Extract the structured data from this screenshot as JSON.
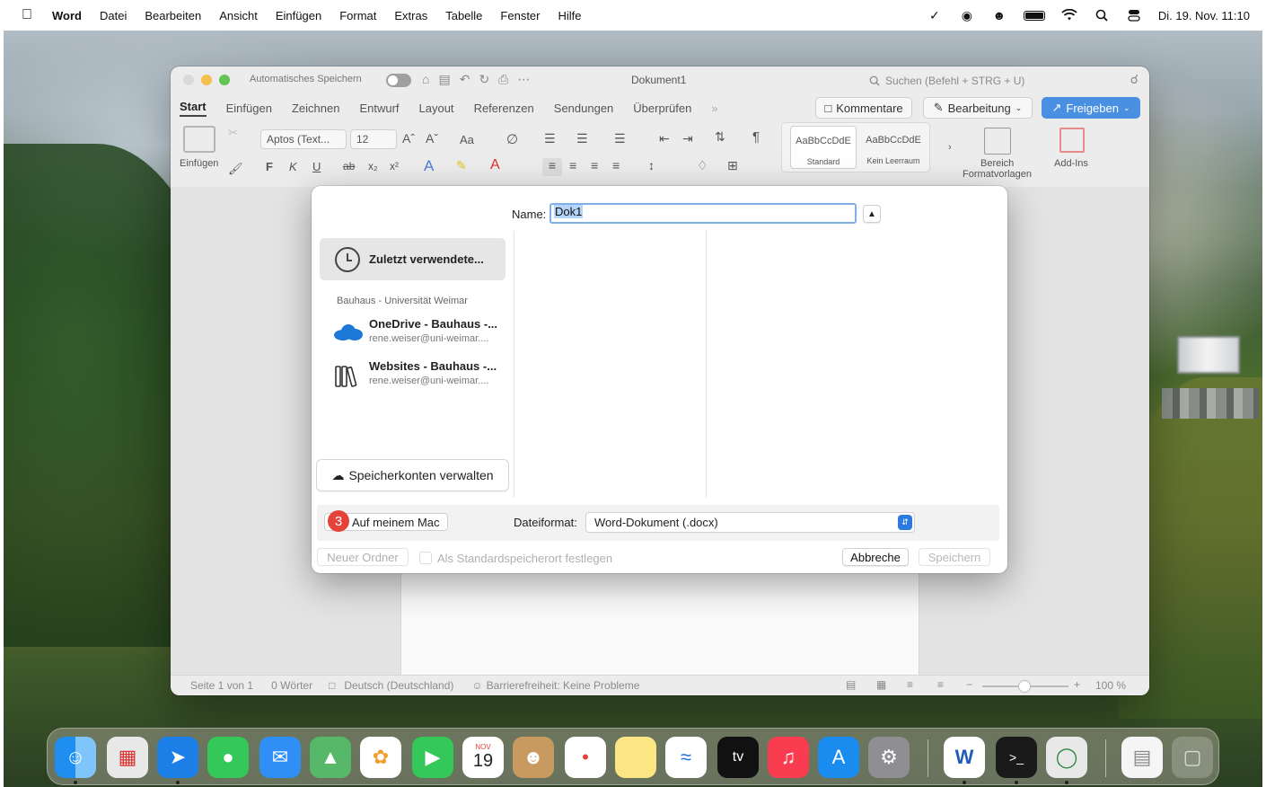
{
  "menubar": {
    "app_name": "Word",
    "items": [
      "Datei",
      "Bearbeiten",
      "Ansicht",
      "Einfügen",
      "Format",
      "Extras",
      "Tabelle",
      "Fenster",
      "Hilfe"
    ],
    "datetime": "Di. 19. Nov. 11:10"
  },
  "window": {
    "autosave_label": "Automatisches Speichern",
    "doc_title": "Dokument1",
    "search_placeholder": "Suchen (Befehl + STRG + U)",
    "tabs": [
      "Start",
      "Einfügen",
      "Zeichnen",
      "Entwurf",
      "Layout",
      "Referenzen",
      "Sendungen",
      "Überprüfen"
    ],
    "tabs_more": "»",
    "kommentare_label": "Kommentare",
    "bearbeitung_label": "Bearbeitung",
    "freigeben_label": "Freigeben"
  },
  "ribbon": {
    "paste_label": "Einfügen",
    "font_name": "Aptos (Text...",
    "font_size": "12",
    "grow_font": "Aˆ",
    "shrink_font": "Aˇ",
    "change_case": "Aa",
    "bold": "F",
    "italic": "K",
    "underline": "U",
    "strike": "ab",
    "subscript": "x₂",
    "superscript": "x²",
    "style1_preview": "AaBbCcDdE",
    "style1_name": "Standard",
    "style2_preview": "AaBbCcDdE",
    "style2_name": "Kein Leerraum",
    "styles_pane_label_1": "Bereich",
    "styles_pane_label_2": "Formatvorlagen",
    "addins_label": "Add-Ins"
  },
  "statusbar": {
    "page": "Seite 1 von 1",
    "words": "0 Wörter",
    "language": "Deutsch (Deutschland)",
    "accessibility": "Barrierefreiheit: Keine Probleme",
    "zoom": "100 %",
    "zoom_minus": "−",
    "zoom_plus": "+"
  },
  "dialog": {
    "name_label": "Name:",
    "name_value": "Dok1",
    "recent_label": "Zuletzt verwendete...",
    "group_label": "Bauhaus - Universität Weimar",
    "locations": [
      {
        "title": "OneDrive - Bauhaus -...",
        "subtitle": "rene.weiser@uni-weimar...."
      },
      {
        "title": "Websites - Bauhaus -...",
        "subtitle": "rene.weiser@uni-weimar...."
      }
    ],
    "manage_label": "Speicherkonten verwalten",
    "badge_number": "3",
    "location_button": "Auf meinem Mac",
    "format_label": "Dateiformat:",
    "format_value": "Word-Dokument (.docx)",
    "new_folder": "Neuer Ordner",
    "default_checkbox_label": "Als Standardspeicherort festlegen",
    "cancel_label": "Abbreche",
    "save_label": "Speichern"
  },
  "dock": {
    "calendar_month": "NOV",
    "calendar_day": "19",
    "tv_label": "tv",
    "word_letter": "W",
    "terminal_prompt": ">_"
  },
  "colors": {
    "accent_blue": "#4a90e2",
    "badge_red": "#e5433a",
    "select_blue": "#2a7ae2"
  }
}
